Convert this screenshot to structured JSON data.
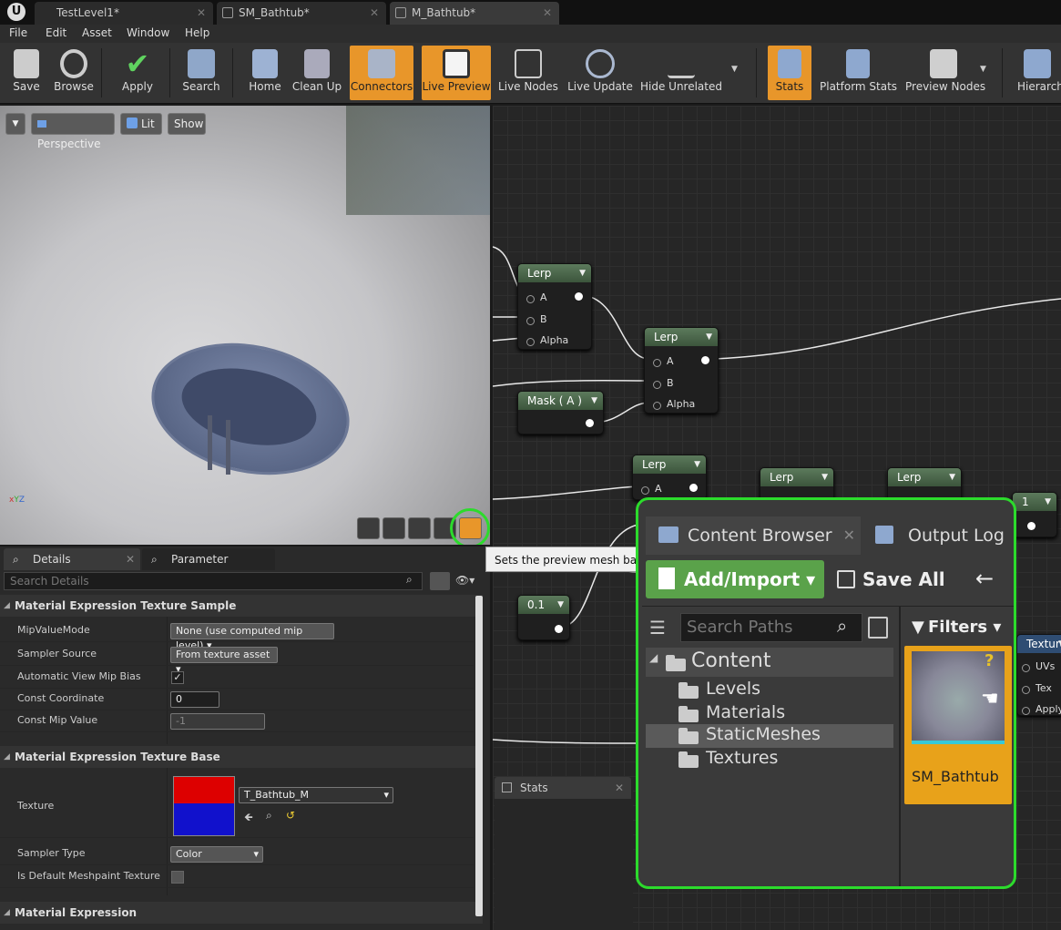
{
  "window_tabs": [
    {
      "label": "TestLevel1*"
    },
    {
      "label": "SM_Bathtub*"
    },
    {
      "label": "M_Bathtub*"
    }
  ],
  "menu": [
    "File",
    "Edit",
    "Asset",
    "Window",
    "Help"
  ],
  "toolbar": [
    {
      "label": "Save",
      "active": false
    },
    {
      "label": "Browse",
      "active": false
    },
    {
      "label": "Apply",
      "active": false
    },
    {
      "label": "Search",
      "active": false
    },
    {
      "label": "Home",
      "active": false
    },
    {
      "label": "Clean Up",
      "active": false
    },
    {
      "label": "Connectors",
      "active": true
    },
    {
      "label": "Live Preview",
      "active": true
    },
    {
      "label": "Live Nodes",
      "active": false
    },
    {
      "label": "Live Update",
      "active": false
    },
    {
      "label": "Hide Unrelated",
      "active": false
    },
    {
      "label": "Stats",
      "active": true
    },
    {
      "label": "Platform Stats",
      "active": false
    },
    {
      "label": "Preview Nodes",
      "active": false
    },
    {
      "label": "Hierarchy",
      "active": false
    }
  ],
  "viewport": {
    "perspective": "Perspective",
    "lit": "Lit",
    "show": "Show"
  },
  "tooltip": "Sets the preview mesh based",
  "details": {
    "tabs": [
      "Details",
      "Parameter Defaults"
    ],
    "search_placeholder": "Search Details",
    "sections": [
      {
        "title": "Material Expression Texture Sample",
        "rows": [
          {
            "label": "MipValueMode",
            "value": "None (use computed mip level)"
          },
          {
            "label": "Sampler Source",
            "value": "From texture asset"
          },
          {
            "label": "Automatic View Mip Bias",
            "value": "checked"
          },
          {
            "label": "Const Coordinate",
            "value": "0"
          },
          {
            "label": "Const Mip Value",
            "value": "-1"
          }
        ]
      },
      {
        "title": "Material Expression Texture Base",
        "rows": [
          {
            "label": "Texture",
            "value": "T_Bathtub_M"
          },
          {
            "label": "Sampler Type",
            "value": "Color"
          },
          {
            "label": "Is Default Meshpaint Texture",
            "value": "unchecked"
          }
        ]
      },
      {
        "title": "Material Expression",
        "rows": []
      }
    ]
  },
  "graph": {
    "nodes": [
      {
        "title": "Lerp",
        "pins": [
          "A",
          "B",
          "Alpha"
        ]
      },
      {
        "title": "Lerp",
        "pins": [
          "A",
          "B",
          "Alpha"
        ]
      },
      {
        "title": "Mask ( A )",
        "pins": []
      },
      {
        "title": "Lerp",
        "pins": [
          "A"
        ]
      },
      {
        "title": "Lerp",
        "pins": []
      },
      {
        "title": "Lerp",
        "pins": []
      },
      {
        "title": "1",
        "pins": []
      },
      {
        "title": "0.1",
        "pins": []
      },
      {
        "title": "Texture",
        "pins": [
          "UVs",
          "Tex",
          "Apply"
        ]
      }
    ]
  },
  "stats_panel": {
    "title": "Stats"
  },
  "content_browser": {
    "tabs": [
      "Content Browser",
      "Output Log"
    ],
    "add_import": "Add/Import",
    "save_all": "Save All",
    "search_paths_placeholder": "Search Paths",
    "filters": "Filters",
    "folders": [
      {
        "name": "Content"
      },
      {
        "name": "Levels"
      },
      {
        "name": "Materials"
      },
      {
        "name": "StaticMeshes"
      },
      {
        "name": "Textures"
      }
    ],
    "asset": {
      "name": "SM_Bathtub"
    }
  }
}
